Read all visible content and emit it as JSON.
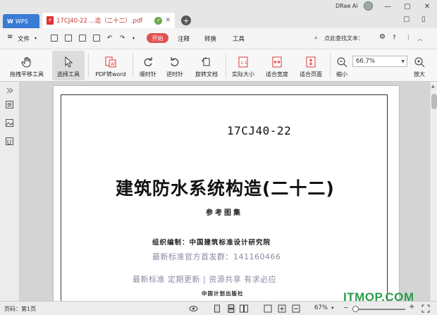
{
  "titlebar": {
    "app_tab": "WPS",
    "app_logo": "W",
    "doc_tab": "17CJ40-22 ...造（二十二）.pdf",
    "pdf_badge": "P",
    "user": "DRae Ai"
  },
  "menu": {
    "file": "文件",
    "start": "开始",
    "annotate": "注释",
    "convert": "转换",
    "tools": "工具",
    "search": "点此查找文本："
  },
  "toolbar": {
    "hand": "拖拽平移工具",
    "select": "选择工具",
    "pdf_to_word": "PDF转word",
    "rotate_cw": "顺时针",
    "rotate_ccw": "逆时针",
    "rotate_doc": "旋转文档",
    "actual_size": "实际大小",
    "fit_width": "适合宽度",
    "fit_page": "适合页面",
    "zoom_out": "缩小",
    "zoom_value": "66.7%",
    "zoom_in": "放大"
  },
  "document": {
    "code": "17CJ40-22",
    "title": "建筑防水系统构造(二十二)",
    "subtitle": "参考图集",
    "org": "组织编制：中国建筑标准设计研究院",
    "qq": "最新标准官方首发群：141160466",
    "slogan": "最新标准  定期更新  |  资源共享  有求必应",
    "publisher": "中国计划出版社"
  },
  "status": {
    "page": "页码：第1页",
    "zoom": "67%",
    "minus": "−",
    "plus": "+"
  },
  "watermark": "ITMOP.COM",
  "colors": {
    "accent_blue": "#3a7bd5",
    "start_red": "#e05252",
    "watermark_green": "#2a9d48"
  }
}
